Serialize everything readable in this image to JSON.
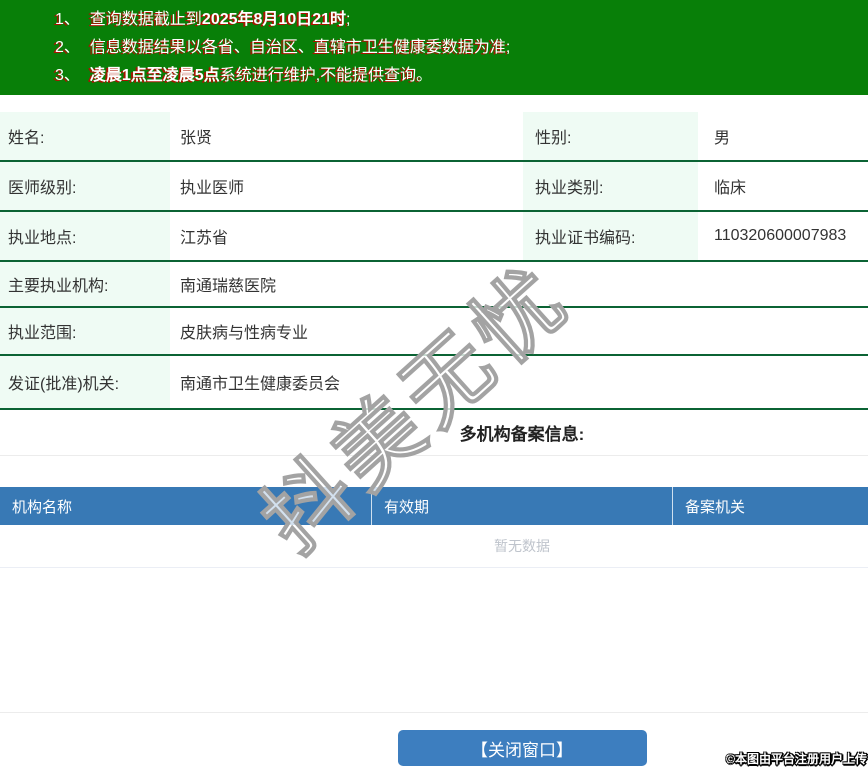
{
  "banner": {
    "bg_color": "#087f08",
    "notices": [
      {
        "num": "1、",
        "pre": "查询数据截止到",
        "bold": "2025年8月10日21时",
        "post": ";"
      },
      {
        "num": "2、",
        "pre": "信息数据结果以各省、自治区、直辖市卫生健康委数据为准;",
        "bold": "",
        "post": ""
      },
      {
        "num": "3、",
        "pre": "",
        "bold": "凌晨1点至凌晨5点",
        "post": "系统进行维护,不能提供查询。"
      }
    ]
  },
  "doctor_info": {
    "rows": [
      {
        "label1": "姓名:",
        "value1": "张贤",
        "label2": "性别:",
        "value2": "男"
      },
      {
        "label1": "医师级别:",
        "value1": "执业医师",
        "label2": "执业类别:",
        "value2": "临床"
      },
      {
        "label1": "执业地点:",
        "value1": "江苏省",
        "label2": "执业证书编码:",
        "value2": "110320600007983"
      },
      {
        "label1": "主要执业机构:",
        "value1": "南通瑞慈医院"
      },
      {
        "label1": "执业范围:",
        "value1": "皮肤病与性病专业"
      },
      {
        "label1": "发证(批准)机关:",
        "value1": "南通市卫生健康委员会"
      }
    ],
    "label_bg": "#effbf4",
    "row_border_color": "#0b6334"
  },
  "filing_section": {
    "title": "多机构备案信息:",
    "headers": [
      "机构名称",
      "有效期",
      "备案机关"
    ],
    "header_bg": "#3879b5",
    "empty_text": "暂无数据"
  },
  "footer": {
    "close_button_label": "【关闭窗口】",
    "button_color": "#3d7ebf"
  },
  "watermark_text": "抖美无忧",
  "copyright_text": "©本图由平台注册用户上传"
}
